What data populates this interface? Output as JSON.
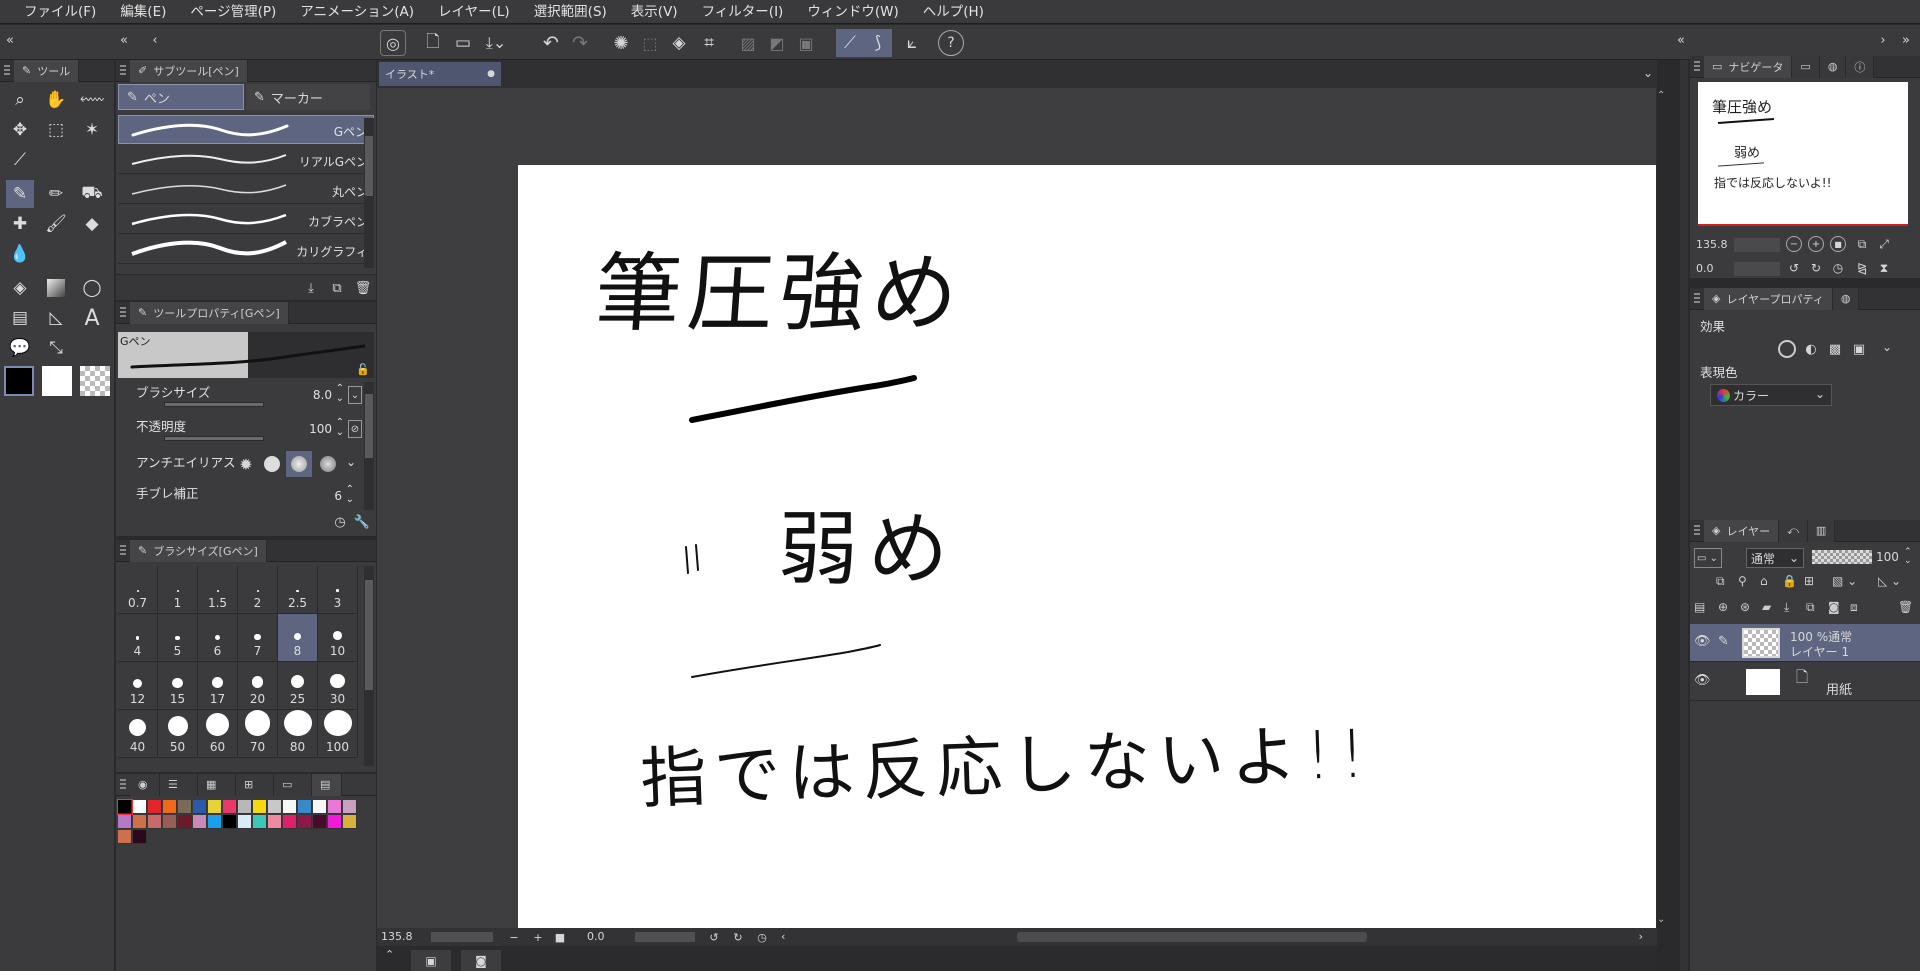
{
  "menu": [
    "ファイル(F)",
    "編集(E)",
    "ページ管理(P)",
    "アニメーション(A)",
    "レイヤー(L)",
    "選択範囲(S)",
    "表示(V)",
    "フィルター(I)",
    "ウィンドウ(W)",
    "ヘルプ(H)"
  ],
  "tool_panel": {
    "tab": "ツール"
  },
  "subtool_panel": {
    "tab": "サブツール[ペン]",
    "groups": [
      "ペン",
      "マーカー"
    ],
    "brushes": [
      "Gペン",
      "リアルGペン",
      "丸ペン",
      "カブラペン",
      "カリグラフィ"
    ]
  },
  "tool_property": {
    "tab": "ツールプロパティ[Gペン]",
    "preview_label": "Gペン",
    "brush_size_label": "ブラシサイズ",
    "brush_size_value": "8.0",
    "opacity_label": "不透明度",
    "opacity_value": "100",
    "antialias_label": "アンチエイリアス",
    "stabilization_label": "手ブレ補正",
    "stabilization_value": "6"
  },
  "brush_size_panel": {
    "tab": "ブラシサイズ[Gペン]",
    "sizes": [
      "0.7",
      "1",
      "1.5",
      "2",
      "2.5",
      "3",
      "4",
      "5",
      "6",
      "7",
      "8",
      "10",
      "12",
      "15",
      "17",
      "20",
      "25",
      "30",
      "40",
      "50",
      "60",
      "70",
      "80",
      "100"
    ],
    "selected": "8"
  },
  "palette": {
    "colors": [
      "#000000",
      "#ffffff",
      "#e2262a",
      "#f06a1a",
      "#7a6a58",
      "#2c5aa8",
      "#e8d238",
      "#e8396a",
      "#b8b8b8",
      "#f5d80e",
      "#c8c8c8",
      "#f7f7f7",
      "#3a8acb",
      "#f6f6f6",
      "#e87ad6",
      "#c8a0c0",
      "#b47ac8",
      "#d0704a",
      "#c86a6a",
      "#9a5c56",
      "#6a1a28",
      "#c88ab8",
      "#1aa0e8",
      "#000000",
      "#d8ecf6",
      "#3ac8b8",
      "#f08aa0",
      "#e0206a",
      "#8a1a4a",
      "#4a0a2a",
      "#f01ad8",
      "#d8b040",
      "#cc7050",
      "#2a0a1a"
    ]
  },
  "canvas_tab": "イラスト*",
  "canvas_text": {
    "line1": "筆圧強め",
    "line2_mark": "〃",
    "line2": "弱め",
    "line3": "指では反応しないよ!!"
  },
  "status": {
    "zoom": "135.8",
    "angle": "0.0"
  },
  "navigator": {
    "tab": "ナビゲータ",
    "zoom": "135.8",
    "angle": "0.0"
  },
  "layer_property": {
    "tab": "レイヤープロパティ",
    "effect_label": "効果",
    "expression_label": "表現色",
    "expression_value": "カラー"
  },
  "layers": {
    "tab": "レイヤー",
    "blend_mode": "通常",
    "opacity": "100",
    "items": [
      {
        "line1": "100 %通常",
        "line2": "レイヤー 1"
      },
      {
        "line1": "",
        "line2": "用紙"
      }
    ]
  }
}
